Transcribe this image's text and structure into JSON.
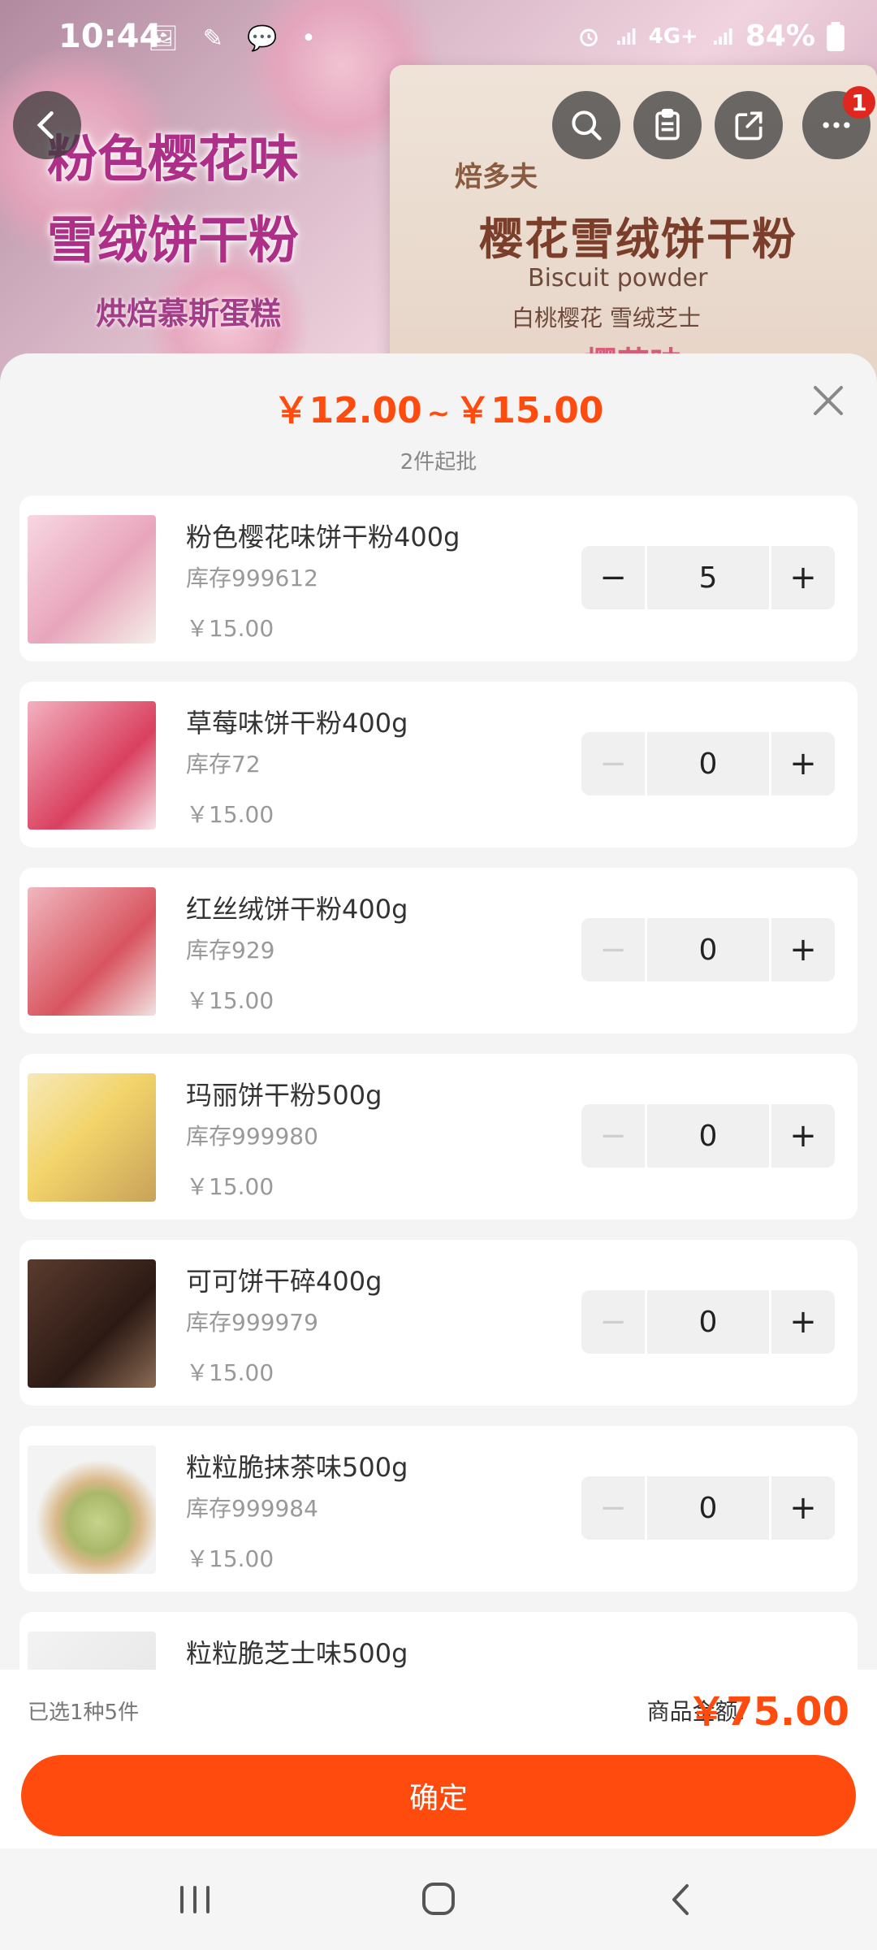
{
  "status_bar": {
    "time": "10:44",
    "notif_icons": "🖼 ✎ 💬 •",
    "battery": "84%",
    "network": "4G+"
  },
  "banner": {
    "promo_line1": "粉色樱花味",
    "promo_line2": "雪绒饼干粉",
    "promo_line3": "烘焙慕斯蛋糕",
    "bag_brand": "焙多夫",
    "bag_title": "樱花雪绒饼干粉",
    "bag_sub": "Biscuit powder",
    "bag_sub2": "白桃樱花 雪绒芝士",
    "bag_flavor": "樱花味"
  },
  "header": {
    "badge_count": "1"
  },
  "sheet": {
    "price_low": "￥12.00",
    "tilde": "~",
    "price_high": "￥15.00",
    "min_order": "2件起批"
  },
  "products": [
    {
      "name": "粉色樱花味饼干粉400g",
      "stock": "库存999612",
      "price": "￥15.00",
      "qty": "5",
      "minus_enabled": true
    },
    {
      "name": "草莓味饼干粉400g",
      "stock": "库存72",
      "price": "￥15.00",
      "qty": "0",
      "minus_enabled": false
    },
    {
      "name": "红丝绒饼干粉400g",
      "stock": "库存929",
      "price": "￥15.00",
      "qty": "0",
      "minus_enabled": false
    },
    {
      "name": "玛丽饼干粉500g",
      "stock": "库存999980",
      "price": "￥15.00",
      "qty": "0",
      "minus_enabled": false
    },
    {
      "name": "可可饼干碎400g",
      "stock": "库存999979",
      "price": "￥15.00",
      "qty": "0",
      "minus_enabled": false
    },
    {
      "name": "粒粒脆抹茶味500g",
      "stock": "库存999984",
      "price": "￥15.00",
      "qty": "0",
      "minus_enabled": false
    },
    {
      "name": "粒粒脆芝士味500g",
      "stock": "",
      "price": "",
      "qty": "",
      "minus_enabled": false
    }
  ],
  "stepper": {
    "minus": "−",
    "plus": "+"
  },
  "summary": {
    "selected": "已选1种5件",
    "amount_label": "商品金额:",
    "amount": "￥75.00",
    "confirm": "确定"
  },
  "colors": {
    "accent": "#ff4b0e",
    "badge": "#e0271f"
  }
}
